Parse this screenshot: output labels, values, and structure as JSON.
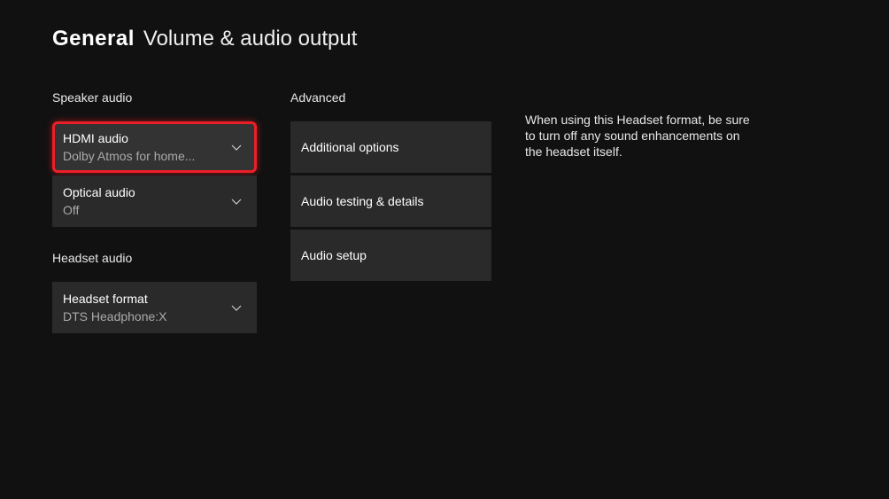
{
  "header": {
    "general": "General",
    "subtitle": "Volume & audio output"
  },
  "speaker_audio": {
    "label": "Speaker audio",
    "hdmi": {
      "title": "HDMI audio",
      "value": "Dolby Atmos for home..."
    },
    "optical": {
      "title": "Optical audio",
      "value": "Off"
    }
  },
  "headset_audio": {
    "label": "Headset audio",
    "format": {
      "title": "Headset format",
      "value": "DTS Headphone:X"
    }
  },
  "advanced": {
    "label": "Advanced",
    "additional_options": "Additional options",
    "audio_testing": "Audio testing & details",
    "audio_setup": "Audio setup"
  },
  "help": {
    "text": "When using this Headset format, be sure to turn off any sound enhancements on the headset itself."
  }
}
